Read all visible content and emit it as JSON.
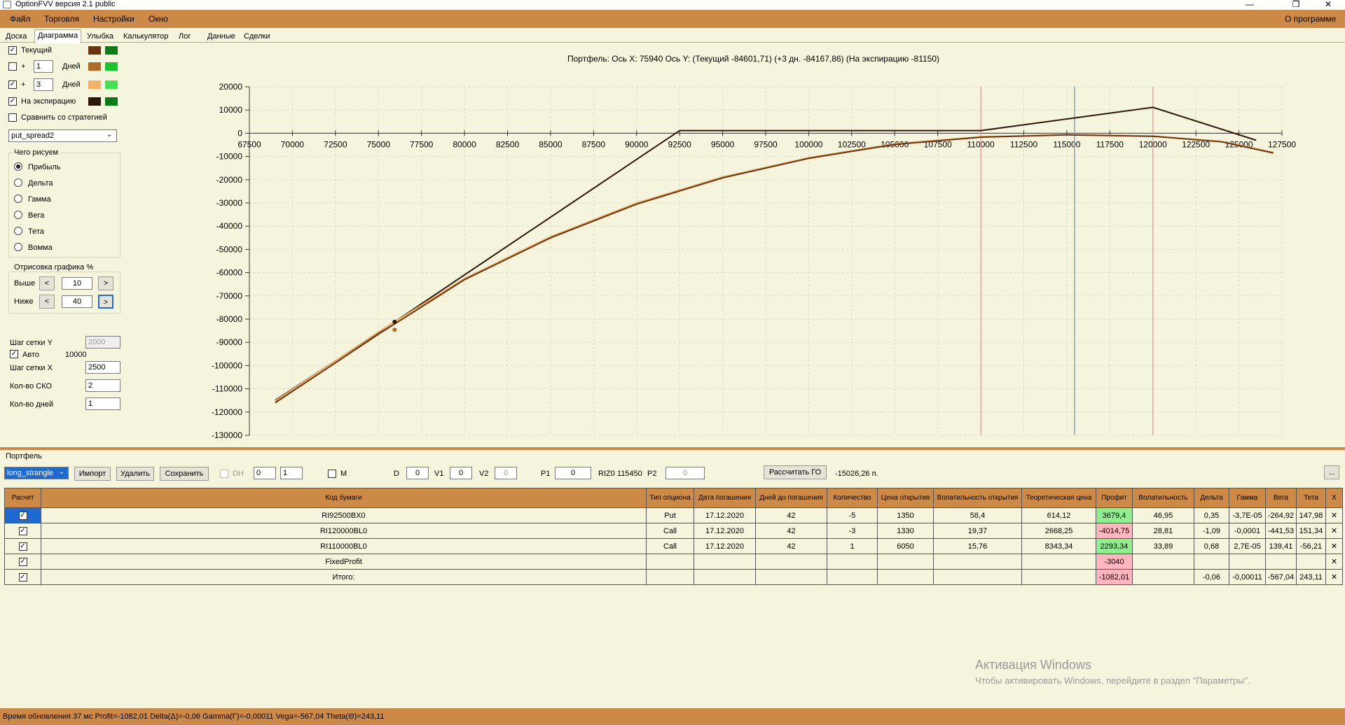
{
  "window": {
    "title": "OptionFVV версия 2.1 public",
    "minimize": "—",
    "maximize": "❐",
    "close": "✕"
  },
  "menu": {
    "items": [
      "Файл",
      "Торговля",
      "Настройки",
      "Окно"
    ],
    "about": "О программе"
  },
  "tabs": [
    "Доска",
    "Диаграмма",
    "Улыбка",
    "Калькулятор",
    "Лог",
    "Данные",
    "Сделки"
  ],
  "active_tab": "Диаграмма",
  "left_panel": {
    "current": {
      "label": "Текущий",
      "checked": true,
      "color1": "#6b3410",
      "color2": "#0d7a1a"
    },
    "plus1": {
      "plus": "+",
      "days": "1",
      "unit": "Дней",
      "checked": false,
      "color1": "#b06a2c",
      "color2": "#19c52e"
    },
    "plus3": {
      "plus": "+",
      "days": "3",
      "unit": "Дней",
      "checked": true,
      "color1": "#f2b068",
      "color2": "#43e04f"
    },
    "expiry": {
      "label": "На экспирацию",
      "checked": true,
      "color1": "#2b160a",
      "color2": "#0d7a1a"
    },
    "compare": {
      "label": "Сравнить со стратегией",
      "checked": false
    },
    "strategy": "put_spread2",
    "what_group": "Чего рисуем",
    "radios": [
      "Прибыль",
      "Дельта",
      "Гамма",
      "Вега",
      "Тета",
      "Вомма"
    ],
    "radio_selected": 0,
    "draw_group": "Отрисовка графика %",
    "above": {
      "label": "Выше",
      "value": "10"
    },
    "below": {
      "label": "Ниже",
      "value": "40"
    },
    "nav_prev": "<",
    "nav_next": ">",
    "grid_y": {
      "label": "Шаг сетки Y",
      "value": "2000"
    },
    "auto": {
      "label": "Авто",
      "value": "10000",
      "checked": true
    },
    "grid_x": {
      "label": "Шаг сетки X",
      "value": "2500"
    },
    "sko": {
      "label": "Кол-во СКО",
      "value": "2"
    },
    "days": {
      "label": "Кол-во дней",
      "value": "1"
    }
  },
  "chart_data": {
    "type": "line",
    "title": "Портфель:  Ось X:  75940  Ось Y:   (Текущий  -84601,71)   (+3 дн.  -84167,86)   (На экспирацию  -81150)",
    "xlim": [
      67500,
      127500
    ],
    "ylim": [
      -130000,
      20000
    ],
    "x_ticks": [
      "67500",
      "70000",
      "72500",
      "75000",
      "77500",
      "80000",
      "82500",
      "85000",
      "87500",
      "90000",
      "92500",
      "95000",
      "97500",
      "100000",
      "102500",
      "105000",
      "107500",
      "110000",
      "112500",
      "115000",
      "117500",
      "120000",
      "122500",
      "125000",
      "127500"
    ],
    "y_ticks": [
      "20000",
      "10000",
      "0",
      "-10000",
      "-20000",
      "-30000",
      "-40000",
      "-50000",
      "-60000",
      "-70000",
      "-80000",
      "-90000",
      "-100000",
      "-110000",
      "-120000",
      "-130000"
    ],
    "vertical_markers": [
      {
        "x": 110000,
        "color": "#f2a0a0"
      },
      {
        "x": 115450,
        "color": "#8aa0b8"
      },
      {
        "x": 120000,
        "color": "#f2a0a0"
      }
    ],
    "cursor_x": 75940,
    "series": [
      {
        "color": "#2b160a",
        "x": [
          69000,
          75940,
          92500,
          110000,
          120000,
          126000
        ],
        "y": [
          -115000,
          -81150,
          1150,
          1150,
          11150,
          -3000
        ]
      },
      {
        "color": "#f2b068",
        "x": [
          69000,
          75000,
          80000,
          85000,
          90000,
          95000,
          100000,
          105000,
          110000,
          115000,
          120000,
          124000,
          127000
        ],
        "y": [
          -115300,
          -85500,
          -62500,
          -44500,
          -30000,
          -18800,
          -10500,
          -4500,
          -1500,
          -600,
          -1200,
          -3500,
          -8200
        ]
      },
      {
        "color": "#6b3410",
        "x": [
          69000,
          75000,
          80000,
          85000,
          90000,
          95000,
          100000,
          105000,
          110000,
          115000,
          120000,
          124000,
          127000
        ],
        "y": [
          -116000,
          -86500,
          -63000,
          -45000,
          -30500,
          -19200,
          -10800,
          -4800,
          -1700,
          -700,
          -1300,
          -3700,
          -8500
        ]
      }
    ],
    "markers": [
      {
        "x": 75940,
        "y": -81150,
        "color": "#2b160a"
      },
      {
        "x": 75940,
        "y": -84601.71,
        "color": "#b06a2c"
      }
    ]
  },
  "portfolio": {
    "label": "Портфель",
    "select": "long_strangle",
    "import": "Импорт",
    "delete": "Удалить",
    "save": "Сохранить",
    "dh": "DH",
    "spin1": "0",
    "spin2": "1",
    "m": "M",
    "d": {
      "label": "D",
      "value": "0"
    },
    "v1": {
      "label": "V1",
      "value": "0"
    },
    "v2": {
      "label": "V2",
      "value": "0"
    },
    "p1": {
      "label": "P1",
      "value": "0"
    },
    "riz": "RIZ0 115450",
    "p2": {
      "label": "P2",
      "value": "0"
    },
    "calc_go": "Рассчитать ГО",
    "go_value": "-15026,26 п.",
    "ellipsis": "..."
  },
  "table": {
    "headers": [
      "Расчет",
      "Код бумаги",
      "Тип опциона",
      "Дата погашения",
      "Дней до погашения",
      "Количество",
      "Цена открытия",
      "Волатильность открытия",
      "Теоретическая цена",
      "Профит",
      "Волатильность",
      "Дельта",
      "Гамма",
      "Вега",
      "Тета",
      "X"
    ],
    "rows": [
      [
        "RI92500BX0",
        "Put",
        "17.12.2020",
        "42",
        "-5",
        "1350",
        "58,4",
        "614,12",
        "3679,4",
        "46,95",
        "0,35",
        "-3,7E-05",
        "-264,92",
        "147,98"
      ],
      [
        "RI120000BL0",
        "Call",
        "17.12.2020",
        "42",
        "-3",
        "1330",
        "19,37",
        "2668,25",
        "-4014,75",
        "28,81",
        "-1,09",
        "-0,0001",
        "-441,53",
        "151,34"
      ],
      [
        "RI110000BL0",
        "Call",
        "17.12.2020",
        "42",
        "1",
        "6050",
        "15,76",
        "8343,34",
        "2293,34",
        "33,89",
        "0,68",
        "2,7E-05",
        "139,41",
        "-56,21"
      ],
      [
        "FixedProfit",
        "",
        "",
        "",
        "",
        "",
        "",
        "",
        "-3040",
        "",
        "",
        "",
        "",
        ""
      ],
      [
        "Итого:",
        "",
        "",
        "",
        "",
        "",
        "",
        "",
        "-1082,01",
        "",
        "-0,06",
        "-0,00011",
        "-567,04",
        "243,11"
      ]
    ],
    "profit_colors": [
      "green",
      "pink",
      "green",
      "pink",
      "pink"
    ],
    "x_mark": "✕",
    "check": "✓"
  },
  "watermark": {
    "line1": "Активация Windows",
    "line2": "Чтобы активировать Windows, перейдите в раздел \"Параметры\"."
  },
  "status": "Время обновления 37 мс  Profit=-1082,01 Delta(Δ)=-0,06 Gamma(Γ)=-0,00011 Vega=-567,04 Theta(Θ)=243,11"
}
